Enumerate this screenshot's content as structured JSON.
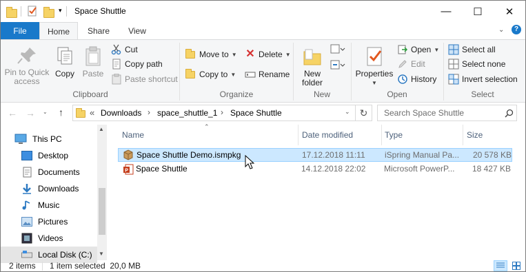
{
  "window": {
    "title": "Space Shuttle",
    "controls": {
      "minimize": "—",
      "maximize": "☐",
      "close": "✕"
    }
  },
  "tabs": [
    {
      "label": "File"
    },
    {
      "label": "Home"
    },
    {
      "label": "Share"
    },
    {
      "label": "View"
    }
  ],
  "ribbon": {
    "clipboard": {
      "pin": "Pin to Quick access",
      "copy": "Copy",
      "paste": "Paste",
      "cut": "Cut",
      "copy_path": "Copy path",
      "paste_shortcut": "Paste shortcut",
      "label": "Clipboard"
    },
    "organize": {
      "move_to": "Move to",
      "copy_to": "Copy to",
      "delete": "Delete",
      "rename": "Rename",
      "label": "Organize"
    },
    "new": {
      "new_folder_1": "New",
      "new_folder_2": "folder",
      "label": "New"
    },
    "open": {
      "properties": "Properties",
      "open": "Open",
      "edit": "Edit",
      "history": "History",
      "label": "Open"
    },
    "select": {
      "select_all": "Select all",
      "select_none": "Select none",
      "invert": "Invert selection",
      "label": "Select"
    }
  },
  "address": {
    "chevrons": "«",
    "crumbs": [
      "Downloads",
      "space_shuttle_1",
      "Space Shuttle"
    ],
    "search_placeholder": "Search Space Shuttle"
  },
  "nav": {
    "items": [
      {
        "label": "This PC",
        "icon": "pc-icon"
      },
      {
        "label": "Desktop",
        "icon": "desktop-icon"
      },
      {
        "label": "Documents",
        "icon": "documents-icon"
      },
      {
        "label": "Downloads",
        "icon": "downloads-icon"
      },
      {
        "label": "Music",
        "icon": "music-icon"
      },
      {
        "label": "Pictures",
        "icon": "pictures-icon"
      },
      {
        "label": "Videos",
        "icon": "videos-icon"
      },
      {
        "label": "Local Disk (C:)",
        "icon": "disk-icon"
      }
    ]
  },
  "list": {
    "columns": [
      "Name",
      "Date modified",
      "Type",
      "Size"
    ],
    "files": [
      {
        "name": "Space Shuttle Demo.ismpkg",
        "date": "17.12.2018 11:11",
        "type": "iSpring Manual Pa...",
        "size": "20 578 KB",
        "selected": true,
        "icon": "package-icon"
      },
      {
        "name": "Space Shuttle",
        "date": "14.12.2018 22:02",
        "type": "Microsoft PowerP...",
        "size": "18 427 KB",
        "selected": false,
        "icon": "powerpoint-icon"
      }
    ]
  },
  "status": {
    "count": "2 items",
    "selected": "1 item selected  20,0 MB"
  },
  "colors": {
    "accent": "#1979ca",
    "selection": "#cce8ff",
    "selection_border": "#99d1ff"
  }
}
